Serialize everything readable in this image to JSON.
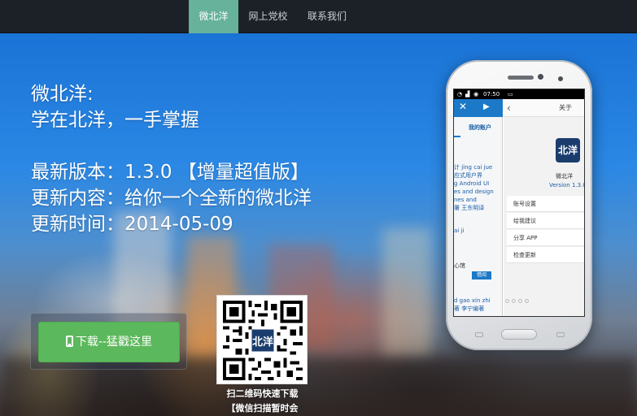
{
  "nav": {
    "items": [
      {
        "label": "微北洋",
        "active": true
      },
      {
        "label": "网上党校",
        "active": false
      },
      {
        "label": "联系我们",
        "active": false
      }
    ]
  },
  "hero": {
    "line1": "微北洋:",
    "line2": "学在北洋，一手掌握",
    "version": "最新版本：1.3.0 【增量超值版】",
    "content": "更新内容：给你一个全新的微北洋",
    "time": "更新时间：2014-05-09"
  },
  "download": {
    "label": "下载--猛戳这里",
    "color": "#5cb85c"
  },
  "qr": {
    "caption1": "扫二维码快速下载",
    "caption2": "【微信扫描暂时会",
    "center_text": "北洋"
  },
  "phone": {
    "status_time": "07:50",
    "left_panel": {
      "tab_label": "我的账户",
      "lines": [
        "计 jing cai jue",
        "应式用户界",
        "g Android UI",
        "es and design",
        "nes and",
        "署 王东明译"
      ],
      "line2": "ai ji",
      "line3": "心馆",
      "badge": "借阅",
      "line4": "d gao xin zhi",
      "line5": "著 李宁编著"
    },
    "right_panel": {
      "header_right": "关于",
      "app_icon_text": "北洋",
      "app_name": "微北洋",
      "app_version": "Version 1.3.0",
      "menu": [
        "账号设置",
        "给我建议",
        "分享 APP",
        "检查更新"
      ]
    }
  },
  "colors": {
    "nav_bg": "#1c2128",
    "nav_active": "#66b29a",
    "accent_blue": "#1c79c7"
  }
}
